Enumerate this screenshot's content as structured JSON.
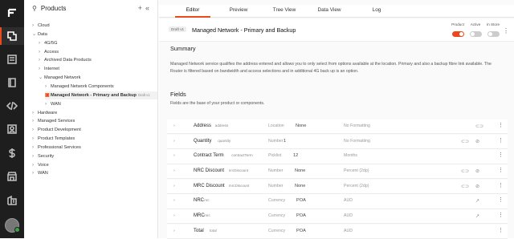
{
  "rail": {
    "icons": [
      "logo-icon",
      "product-icon",
      "document-icon",
      "book-icon",
      "code-icon",
      "contact-icon",
      "dollar-icon",
      "store-icon",
      "building-icon",
      "avatar"
    ]
  },
  "tree": {
    "title": "Products",
    "add_label": "+",
    "collapse_label": "«",
    "nodes": [
      {
        "label": "Cloud",
        "caret": "›"
      },
      {
        "label": "Data",
        "caret": "⌄"
      },
      {
        "label": "4G/5G",
        "caret": "›"
      },
      {
        "label": "Access",
        "caret": "›"
      },
      {
        "label": "Archived Data Products",
        "caret": "›"
      },
      {
        "label": "Internet",
        "caret": "›"
      },
      {
        "label": "Managed Network",
        "caret": "⌄"
      },
      {
        "label": "Managed Network Components",
        "caret": "›"
      },
      {
        "label": "Managed Network - Primary and Backup",
        "chip": "Draft v1",
        "caret": ""
      },
      {
        "label": "WAN",
        "caret": "›"
      },
      {
        "label": "Hardware",
        "caret": "›"
      },
      {
        "label": "Managed Services",
        "caret": "›"
      },
      {
        "label": "Product Development",
        "caret": "›"
      },
      {
        "label": "Product Templates",
        "caret": "›"
      },
      {
        "label": "Professional Services",
        "caret": "›"
      },
      {
        "label": "Security",
        "caret": "›"
      },
      {
        "label": "Voice",
        "caret": "›"
      },
      {
        "label": "WAN",
        "caret": "›"
      }
    ]
  },
  "tabs": [
    "Editor",
    "Preview",
    "Tree View",
    "Data View",
    "Log"
  ],
  "header": {
    "draft": "Draft v1",
    "title": "Managed Network - Primary and Backup",
    "toggles": [
      {
        "label": "Product",
        "on": true
      },
      {
        "label": "Active",
        "on": false
      },
      {
        "label": "In Store",
        "on": false
      }
    ]
  },
  "summary": {
    "heading": "Summary",
    "text": "Managed Network service qualifies the address entered and allows you to only select from options available at the location. Primary and also a backup fibre link available. The Router is filtered based on bandwidth and access selections and in additional 4G back up is an option."
  },
  "fields_section": {
    "heading": "Fields",
    "text": "Fields are the base of your product or components."
  },
  "fields": [
    {
      "name": "Address",
      "key": "address",
      "type": "Location",
      "value": "None",
      "format": "No Formatting",
      "icons": [
        "tag-icon"
      ]
    },
    {
      "name": "Quantity",
      "key": "quantity",
      "type": "Number",
      "value": "1",
      "format": "No Formatting",
      "icons": [
        "tag-icon",
        "eye-off-icon"
      ]
    },
    {
      "name": "Contract Term",
      "key": "contractTerm",
      "type": "Picklist",
      "value": "12",
      "format": "Months",
      "icons": []
    },
    {
      "name": "NRC Discount",
      "key": "nrcDiscount",
      "type": "Number",
      "value": "None",
      "format": "Percent (2dp)",
      "icons": [
        "tag-icon",
        "eye-off-icon"
      ]
    },
    {
      "name": "MRC Discount",
      "key": "mrcDiscount",
      "type": "Number",
      "value": "None",
      "format": "Percent (2dp)",
      "icons": [
        "tag-icon",
        "eye-off-icon"
      ]
    },
    {
      "name": "NRC",
      "key": "nrc",
      "type": "Currency",
      "value": "POA",
      "format": "AUD",
      "icons": [
        "arrow-icon"
      ]
    },
    {
      "name": "MRC",
      "key": "mrc",
      "type": "Currency",
      "value": "POA",
      "format": "AUD",
      "icons": [
        "arrow-icon"
      ]
    },
    {
      "name": "Total",
      "key": "total",
      "type": "Currency",
      "value": "POA",
      "format": "AUD",
      "icons": []
    }
  ]
}
